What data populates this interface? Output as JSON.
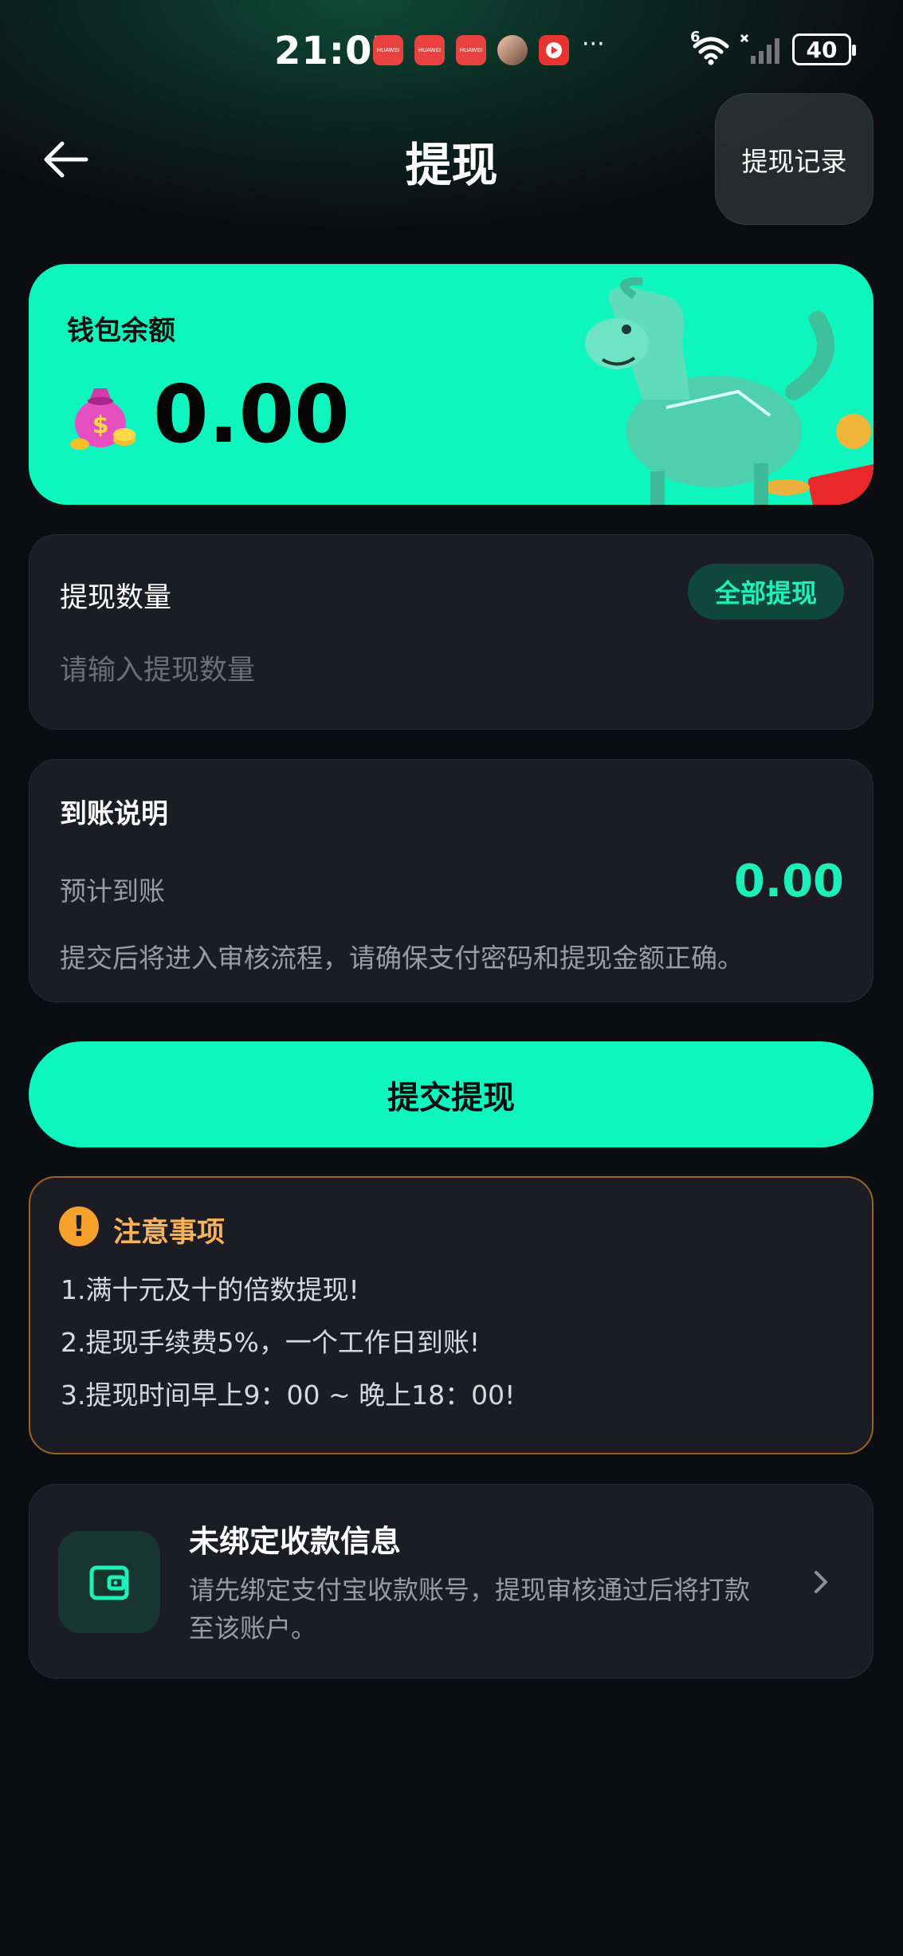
{
  "status_bar": {
    "time": "21:07",
    "app_labels": [
      "HUAWEI",
      "HUAWEI",
      "HUAWEI"
    ],
    "more": "···",
    "network": "6",
    "battery": "40"
  },
  "header": {
    "title": "提现",
    "record_label": "提现记录"
  },
  "balance": {
    "label": "钱包余额",
    "value": "0.00"
  },
  "quantity": {
    "title": "提现数量",
    "all_label": "全部提现",
    "placeholder": "请输入提现数量"
  },
  "arrival": {
    "title": "到账说明",
    "expected_label": "预计到账",
    "expected_value": "0.00",
    "note": "提交后将进入审核流程，请确保支付密码和提现金额正确。"
  },
  "submit_label": "提交提现",
  "notice": {
    "title": "注意事项",
    "items": [
      "1.满十元及十的倍数提现!",
      "2.提现手续费5%，一个工作日到账!",
      "3.提现时间早上9：00 ~ 晚上18：00!"
    ]
  },
  "bind": {
    "title": "未绑定收款信息",
    "desc": "请先绑定支付宝收款账号，提现审核通过后将打款至该账户。"
  },
  "colors": {
    "accent": "#0ef5bd",
    "background": "#0c0d11",
    "panel": "#1c1d24",
    "warning": "#f6a12e"
  }
}
